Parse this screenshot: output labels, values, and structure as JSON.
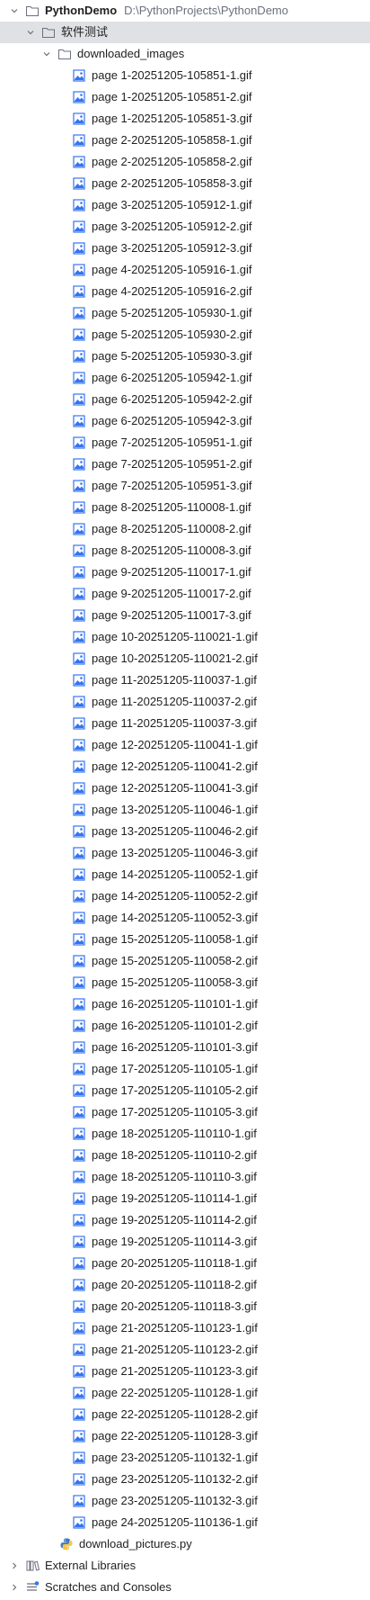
{
  "project": {
    "name": "PythonDemo",
    "path": "D:\\PythonProjects\\PythonDemo"
  },
  "folder_cn": {
    "label": "软件测试"
  },
  "folder_images": {
    "label": "downloaded_images"
  },
  "files": [
    "page 1-20251205-105851-1.gif",
    "page 1-20251205-105851-2.gif",
    "page 1-20251205-105851-3.gif",
    "page 2-20251205-105858-1.gif",
    "page 2-20251205-105858-2.gif",
    "page 2-20251205-105858-3.gif",
    "page 3-20251205-105912-1.gif",
    "page 3-20251205-105912-2.gif",
    "page 3-20251205-105912-3.gif",
    "page 4-20251205-105916-1.gif",
    "page 4-20251205-105916-2.gif",
    "page 5-20251205-105930-1.gif",
    "page 5-20251205-105930-2.gif",
    "page 5-20251205-105930-3.gif",
    "page 6-20251205-105942-1.gif",
    "page 6-20251205-105942-2.gif",
    "page 6-20251205-105942-3.gif",
    "page 7-20251205-105951-1.gif",
    "page 7-20251205-105951-2.gif",
    "page 7-20251205-105951-3.gif",
    "page 8-20251205-110008-1.gif",
    "page 8-20251205-110008-2.gif",
    "page 8-20251205-110008-3.gif",
    "page 9-20251205-110017-1.gif",
    "page 9-20251205-110017-2.gif",
    "page 9-20251205-110017-3.gif",
    "page 10-20251205-110021-1.gif",
    "page 10-20251205-110021-2.gif",
    "page 11-20251205-110037-1.gif",
    "page 11-20251205-110037-2.gif",
    "page 11-20251205-110037-3.gif",
    "page 12-20251205-110041-1.gif",
    "page 12-20251205-110041-2.gif",
    "page 12-20251205-110041-3.gif",
    "page 13-20251205-110046-1.gif",
    "page 13-20251205-110046-2.gif",
    "page 13-20251205-110046-3.gif",
    "page 14-20251205-110052-1.gif",
    "page 14-20251205-110052-2.gif",
    "page 14-20251205-110052-3.gif",
    "page 15-20251205-110058-1.gif",
    "page 15-20251205-110058-2.gif",
    "page 15-20251205-110058-3.gif",
    "page 16-20251205-110101-1.gif",
    "page 16-20251205-110101-2.gif",
    "page 16-20251205-110101-3.gif",
    "page 17-20251205-110105-1.gif",
    "page 17-20251205-110105-2.gif",
    "page 17-20251205-110105-3.gif",
    "page 18-20251205-110110-1.gif",
    "page 18-20251205-110110-2.gif",
    "page 18-20251205-110110-3.gif",
    "page 19-20251205-110114-1.gif",
    "page 19-20251205-110114-2.gif",
    "page 19-20251205-110114-3.gif",
    "page 20-20251205-110118-1.gif",
    "page 20-20251205-110118-2.gif",
    "page 20-20251205-110118-3.gif",
    "page 21-20251205-110123-1.gif",
    "page 21-20251205-110123-2.gif",
    "page 21-20251205-110123-3.gif",
    "page 22-20251205-110128-1.gif",
    "page 22-20251205-110128-2.gif",
    "page 22-20251205-110128-3.gif",
    "page 23-20251205-110132-1.gif",
    "page 23-20251205-110132-2.gif",
    "page 23-20251205-110132-3.gif",
    "page 24-20251205-110136-1.gif"
  ],
  "python_file": {
    "label": "download_pictures.py"
  },
  "external_libraries": {
    "label": "External Libraries"
  },
  "scratches": {
    "label": "Scratches and Consoles"
  },
  "colors": {
    "selected_row": "#dfe1e5",
    "image_icon": "#3574f0",
    "path_text": "#6c707e"
  }
}
